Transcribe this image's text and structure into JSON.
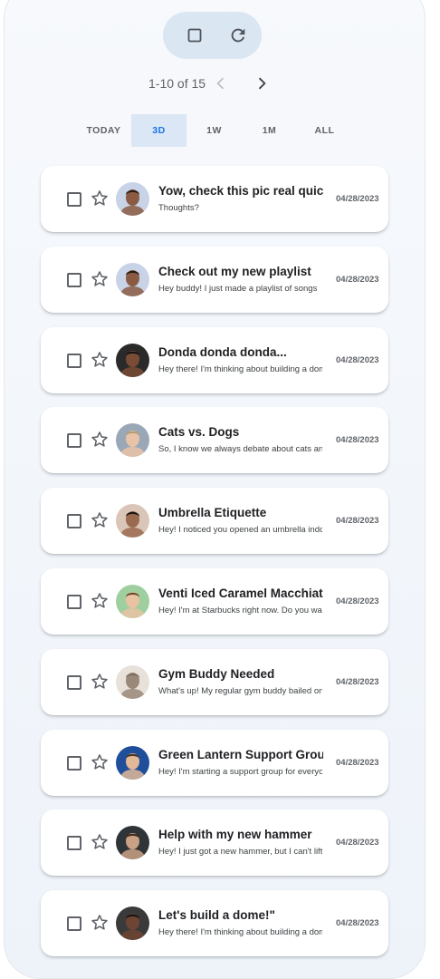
{
  "toolbar": {
    "select_all_icon": "checkbox-outline-icon",
    "refresh_icon": "refresh-icon"
  },
  "pager": {
    "range_text": "1-10 of 15",
    "prev_icon": "chevron-left-icon",
    "next_icon": "chevron-right-icon"
  },
  "filters": {
    "selected": "3D",
    "tabs": [
      {
        "label": "TODAY"
      },
      {
        "label": "3D"
      },
      {
        "label": "1W"
      },
      {
        "label": "1M"
      },
      {
        "label": "ALL"
      }
    ]
  },
  "emails": [
    {
      "subject": "Yow, check this pic real quick",
      "snippet": "Thoughts?",
      "date": "04/28/2023",
      "starred": false,
      "avatar": {
        "bg": "#c9d3e8",
        "skin": "#8a5b42",
        "hair": "#2b1b14"
      }
    },
    {
      "subject": "Check out my new playlist",
      "snippet": "Hey buddy! I just made a playlist of songs",
      "date": "04/28/2023",
      "starred": false,
      "avatar": {
        "bg": "#c9d3e8",
        "skin": "#8a5b42",
        "hair": "#2b1b14"
      }
    },
    {
      "subject": "Donda donda donda...",
      "snippet": "Hey there! I'm thinking about building a dome",
      "date": "04/28/2023",
      "starred": false,
      "avatar": {
        "bg": "#2a2a2a",
        "skin": "#7a4c36",
        "hair": "#151515"
      }
    },
    {
      "subject": "Cats vs. Dogs",
      "snippet": "So, I know we always debate about cats and dogs",
      "date": "04/28/2023",
      "starred": false,
      "avatar": {
        "bg": "#9aa7b6",
        "skin": "#e9c3a8",
        "hair": "#b89c72"
      }
    },
    {
      "subject": "Umbrella Etiquette",
      "snippet": "Hey! I noticed you opened an umbrella indoors",
      "date": "04/28/2023",
      "starred": false,
      "avatar": {
        "bg": "#d9c6b8",
        "skin": "#9a6a4e",
        "hair": "#1e1410"
      }
    },
    {
      "subject": "Venti Iced Caramel Macchiato",
      "snippet": "Hey! I'm at Starbucks right now. Do you want",
      "date": "04/28/2023",
      "starred": false,
      "avatar": {
        "bg": "#9fcf9f",
        "skin": "#e8c2a3",
        "hair": "#6e4a2c"
      }
    },
    {
      "subject": "Gym Buddy Needed",
      "snippet": "What's up! My regular gym buddy bailed on me",
      "date": "04/28/2023",
      "starred": false,
      "avatar": {
        "bg": "#e7e1da",
        "skin": "#9a8878",
        "hair": "#7d6f63"
      }
    },
    {
      "subject": "Green Lantern Support Group",
      "snippet": "Hey! I'm starting a support group for everyone",
      "date": "04/28/2023",
      "starred": false,
      "avatar": {
        "bg": "#1f4f9a",
        "skin": "#e2b898",
        "hair": "#4a3324"
      }
    },
    {
      "subject": "Help with my new hammer",
      "snippet": "Hey! I just got a new hammer, but I can't lift it",
      "date": "04/28/2023",
      "starred": false,
      "avatar": {
        "bg": "#2f3438",
        "skin": "#caa184",
        "hair": "#3b2a1d"
      }
    },
    {
      "subject": "Let's build a dome!\"",
      "snippet": "Hey there! I'm thinking about building a dome",
      "date": "04/28/2023",
      "starred": false,
      "avatar": {
        "bg": "#3a3a3a",
        "skin": "#6e4534",
        "hair": "#141414"
      }
    }
  ],
  "colors": {
    "accent": "#1a73e8",
    "active_tab_bg": "#dbe7f5",
    "toolbar_bg": "#dbe6f3",
    "icon_gray": "#5f6368"
  }
}
